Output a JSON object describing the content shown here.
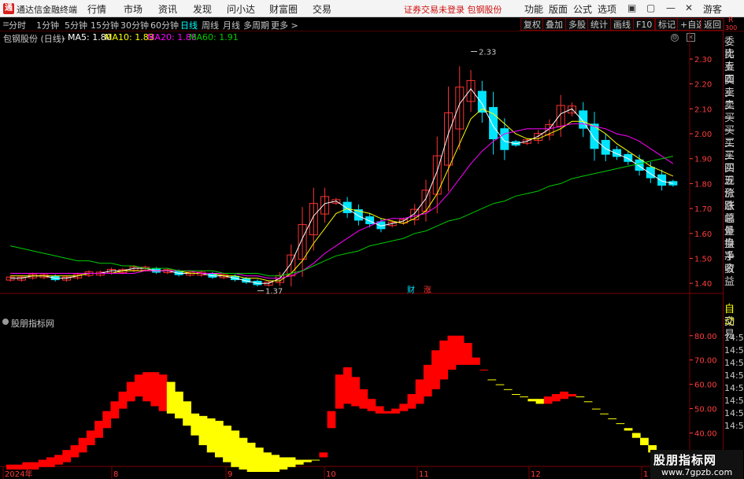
{
  "titlebar": {
    "logo": "通",
    "app_title": "通达信金融终端",
    "menus": [
      "行情",
      "市场",
      "资讯",
      "发现",
      "问小达",
      "财富圈",
      "交易"
    ],
    "notice": "证券交易未登录  包钢股份",
    "right_menus": [
      "功能",
      "版面",
      "公式",
      "选项"
    ],
    "guest": "游客"
  },
  "periods": [
    "分时",
    "1分钟",
    "5分钟",
    "15分钟",
    "30分钟",
    "60分钟",
    "日线",
    "周线",
    "月线",
    "多周期",
    "更多 >"
  ],
  "selected_period": "日线",
  "toolbar": [
    "复权",
    "叠加",
    "多股",
    "统计",
    "画线",
    "F10",
    "标记",
    "+自选",
    "返回"
  ],
  "info": {
    "stock": "包钢股份 (日线)",
    "ma5": "MA5: 1.80",
    "ma10": "MA10: 1.83",
    "ma20": "MA20: 1.88",
    "ma60": "MA60: 1.91"
  },
  "indicator_title": "股朋指标网",
  "right_panel": {
    "header_r": "R",
    "header_num": "300",
    "items": [
      "委比",
      "卖五",
      "卖四",
      "卖三",
      "卖二",
      "卖一",
      "买一",
      "买二",
      "买三",
      "买四",
      "买五",
      "现价",
      "涨跌",
      "涨幅",
      "总量",
      "外盘",
      "换手",
      "净资",
      "收益",
      "自动",
      "交易"
    ],
    "times": [
      "14:5",
      "14:5",
      "14:5",
      "14:5",
      "14:5",
      "14:5",
      "14:5",
      "14:5"
    ]
  },
  "badges": {
    "cai": "财",
    "zhang": "涨"
  },
  "colors": {
    "up": "#ff3232",
    "down": "#00e5ff",
    "ma5": "#ffffff",
    "ma10": "#ffff00",
    "ma20": "#ff00ff",
    "ma60": "#00cc00",
    "ind_red": "#ff0000",
    "ind_yellow": "#ffff00"
  },
  "watermark": {
    "title": "股朋指标网",
    "url": "www.7gpzb.com"
  },
  "chart_data": [
    {
      "type": "candlestick",
      "price_axis": [
        2.3,
        2.2,
        2.1,
        2.0,
        1.9,
        1.8,
        1.7,
        1.6,
        1.5,
        1.4
      ],
      "ylim": [
        1.35,
        2.36
      ],
      "annotations": [
        {
          "label": "2.33",
          "value": 2.33
        },
        {
          "label": "1.37",
          "value": 1.37
        }
      ],
      "x_ticks": [
        "2024年",
        "8",
        "9",
        "10",
        "11",
        "12",
        "1"
      ],
      "series": [
        {
          "name": "MA5",
          "values": [
            1.42,
            1.42,
            1.43,
            1.43,
            1.42,
            1.42,
            1.43,
            1.44,
            1.44,
            1.45,
            1.45,
            1.46,
            1.46,
            1.45,
            1.45,
            1.44,
            1.44,
            1.44,
            1.43,
            1.43,
            1.42,
            1.41,
            1.4,
            1.4,
            1.42,
            1.48,
            1.58,
            1.67,
            1.72,
            1.73,
            1.7,
            1.67,
            1.65,
            1.63,
            1.64,
            1.65,
            1.68,
            1.74,
            1.85,
            2.0,
            2.12,
            2.18,
            2.12,
            2.03,
            1.97,
            1.96,
            1.97,
            1.99,
            2.02,
            2.08,
            2.1,
            2.05,
            1.98,
            1.94,
            1.92,
            1.9,
            1.87,
            1.84,
            1.81,
            1.8
          ]
        },
        {
          "name": "MA10",
          "values": [
            1.43,
            1.43,
            1.43,
            1.43,
            1.43,
            1.43,
            1.43,
            1.44,
            1.44,
            1.44,
            1.45,
            1.45,
            1.45,
            1.45,
            1.45,
            1.45,
            1.44,
            1.44,
            1.44,
            1.43,
            1.43,
            1.42,
            1.42,
            1.41,
            1.41,
            1.44,
            1.49,
            1.56,
            1.62,
            1.68,
            1.7,
            1.69,
            1.68,
            1.66,
            1.65,
            1.64,
            1.66,
            1.69,
            1.76,
            1.86,
            1.96,
            2.06,
            2.1,
            2.08,
            2.04,
            2.0,
            1.98,
            1.98,
            2.0,
            2.02,
            2.05,
            2.05,
            2.03,
            2.0,
            1.96,
            1.93,
            1.9,
            1.87,
            1.85,
            1.83
          ]
        },
        {
          "name": "MA20",
          "values": [
            1.44,
            1.44,
            1.44,
            1.44,
            1.44,
            1.44,
            1.44,
            1.44,
            1.44,
            1.44,
            1.44,
            1.44,
            1.45,
            1.45,
            1.45,
            1.45,
            1.45,
            1.44,
            1.44,
            1.44,
            1.44,
            1.43,
            1.43,
            1.42,
            1.42,
            1.43,
            1.45,
            1.48,
            1.52,
            1.55,
            1.58,
            1.61,
            1.63,
            1.65,
            1.66,
            1.66,
            1.67,
            1.68,
            1.71,
            1.76,
            1.82,
            1.88,
            1.93,
            1.97,
            2.0,
            2.01,
            2.02,
            2.02,
            2.02,
            2.03,
            2.04,
            2.04,
            2.03,
            2.02,
            2.0,
            1.99,
            1.97,
            1.94,
            1.91,
            1.88
          ]
        },
        {
          "name": "MA60",
          "values": [
            1.55,
            1.54,
            1.53,
            1.52,
            1.51,
            1.5,
            1.49,
            1.49,
            1.48,
            1.48,
            1.47,
            1.47,
            1.46,
            1.46,
            1.46,
            1.45,
            1.45,
            1.45,
            1.45,
            1.44,
            1.44,
            1.44,
            1.44,
            1.43,
            1.43,
            1.44,
            1.45,
            1.47,
            1.49,
            1.51,
            1.52,
            1.53,
            1.55,
            1.56,
            1.57,
            1.58,
            1.6,
            1.61,
            1.63,
            1.65,
            1.66,
            1.68,
            1.7,
            1.72,
            1.73,
            1.75,
            1.76,
            1.77,
            1.79,
            1.8,
            1.82,
            1.83,
            1.84,
            1.85,
            1.86,
            1.87,
            1.88,
            1.89,
            1.9,
            1.91
          ]
        }
      ]
    },
    {
      "type": "area",
      "name": "股朋指标网",
      "y_ticks": [
        80.0,
        70.0,
        60.0,
        50.0,
        40.0,
        30.0
      ],
      "ylim": [
        24,
        88
      ],
      "upper": [
        27,
        27,
        28,
        28,
        29,
        30,
        31,
        33,
        35,
        38,
        41,
        45,
        49,
        53,
        57,
        61,
        64,
        65,
        65,
        64,
        61,
        57,
        53,
        48,
        47,
        46,
        45,
        43,
        41,
        38,
        36,
        34,
        32,
        31,
        30,
        30,
        29,
        29,
        29,
        32,
        49,
        64,
        67,
        63,
        58,
        54,
        51,
        49,
        50,
        52,
        56,
        62,
        68,
        74,
        78,
        80,
        80,
        77,
        71,
        66,
        62,
        60,
        58,
        56,
        55,
        54,
        54,
        55,
        56,
        57,
        56,
        55,
        53,
        50,
        48,
        46,
        44,
        42,
        40,
        38,
        35,
        33,
        31,
        29
      ],
      "lower": [
        25,
        25,
        25,
        25,
        26,
        26,
        27,
        28,
        30,
        32,
        35,
        38,
        42,
        46,
        50,
        53,
        55,
        53,
        51,
        49,
        48,
        46,
        43,
        39,
        35,
        32,
        30,
        28,
        26,
        25,
        24,
        24,
        24,
        24,
        25,
        26,
        27,
        28,
        29,
        30,
        42,
        50,
        52,
        51,
        50,
        49,
        48,
        48,
        48,
        49,
        50,
        52,
        55,
        58,
        62,
        66,
        68,
        68,
        68,
        67,
        65,
        62,
        60,
        57,
        55,
        53,
        52,
        52,
        53,
        54,
        55,
        56,
        55,
        53,
        50,
        47,
        44,
        41,
        38,
        35,
        32,
        29,
        27,
        25
      ],
      "color": [
        "red",
        "red",
        "red",
        "red",
        "red",
        "red",
        "red",
        "red",
        "red",
        "red",
        "red",
        "red",
        "red",
        "red",
        "red",
        "red",
        "red",
        "red",
        "red",
        "red",
        "yellow",
        "yellow",
        "yellow",
        "yellow",
        "yellow",
        "yellow",
        "yellow",
        "yellow",
        "yellow",
        "yellow",
        "yellow",
        "yellow",
        "yellow",
        "yellow",
        "yellow",
        "yellow",
        "yellow",
        "yellow",
        "yellow",
        "red",
        "red",
        "red",
        "red",
        "red",
        "red",
        "red",
        "red",
        "red",
        "red",
        "red",
        "red",
        "red",
        "red",
        "red",
        "red",
        "red",
        "red",
        "red",
        "red",
        "red",
        "yellow",
        "yellow",
        "yellow",
        "yellow",
        "yellow",
        "yellow",
        "yellow",
        "red",
        "red",
        "red",
        "red",
        "yellow",
        "yellow",
        "yellow",
        "yellow",
        "yellow",
        "yellow",
        "yellow",
        "yellow",
        "yellow",
        "yellow",
        "yellow",
        "yellow",
        "yellow"
      ]
    }
  ]
}
